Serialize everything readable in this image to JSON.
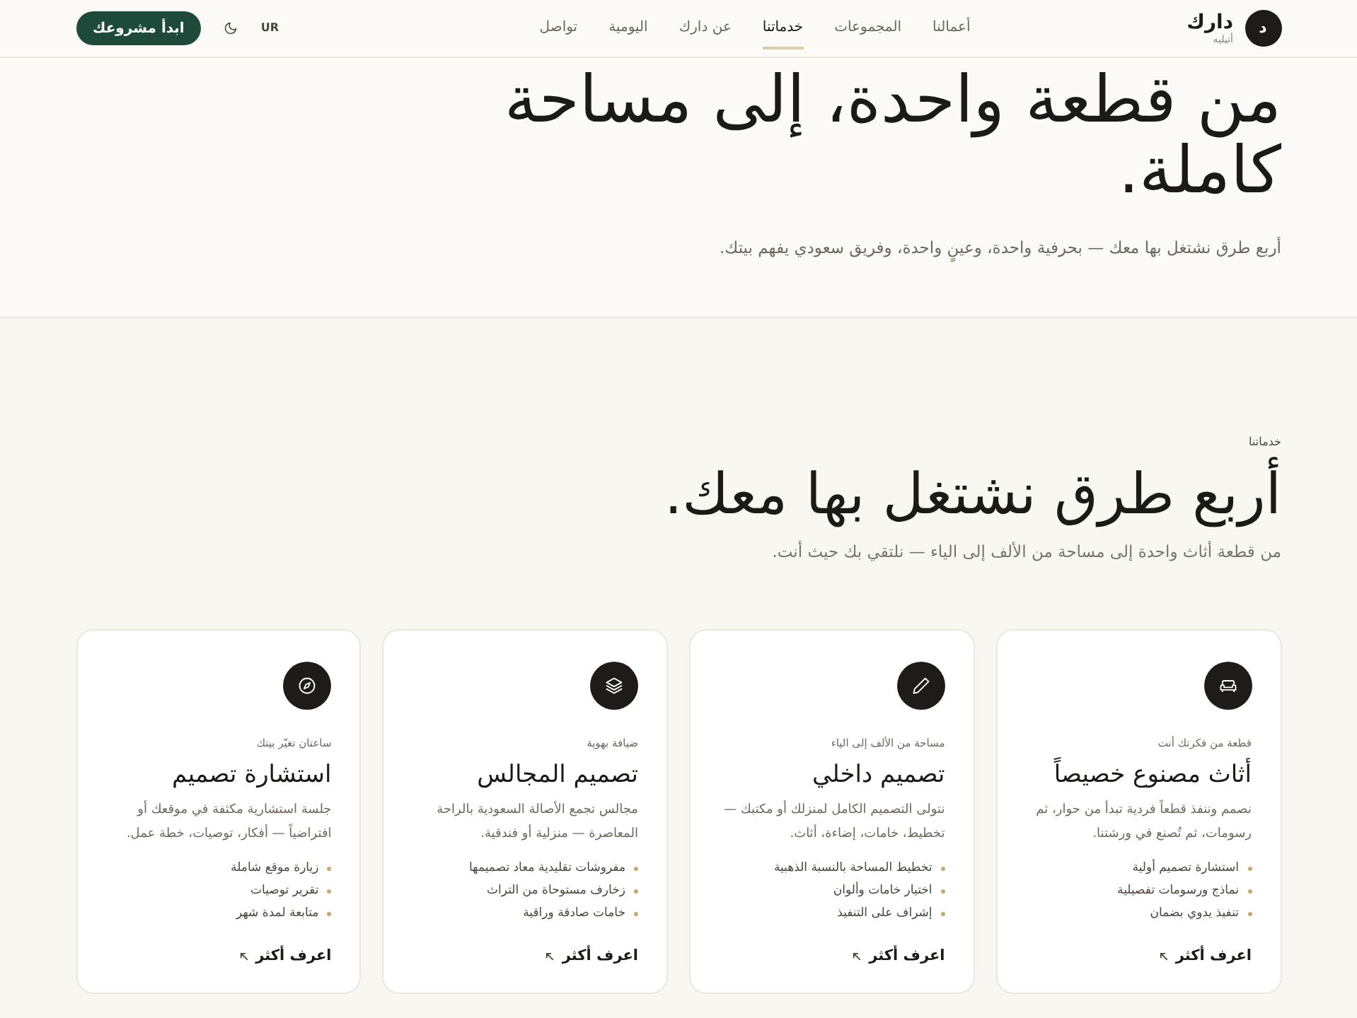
{
  "header": {
    "logo": {
      "mark": "د",
      "name": "دارك",
      "tagline": "أتيليه"
    },
    "nav": [
      {
        "label": "أعمالنا",
        "selected": false
      },
      {
        "label": "المجموعات",
        "selected": false
      },
      {
        "label": "خدماتنا",
        "selected": true
      },
      {
        "label": "عن دارك",
        "selected": false
      },
      {
        "label": "اليومية",
        "selected": false
      },
      {
        "label": "تواصل",
        "selected": false
      }
    ],
    "language": "UR",
    "cta": "ابدأ مشروعك"
  },
  "hero": {
    "title": "من قطعة واحدة، إلى مساحة كاملة.",
    "subtitle": "أربع طرق نشتغل بها معك — بحرفية واحدة، وعينٍ واحدة، وفريق سعودي يفهم بيتك."
  },
  "services": {
    "eyebrow": "خدماتنا",
    "title": "أربع طرق نشتغل بها معك.",
    "subtitle": "من قطعة أثاث واحدة إلى مساحة من الألف إلى الياء — نلتقي بك حيث أنت.",
    "cards": [
      {
        "eyebrow": "قطعة من فكرتك أنت",
        "title": "أثاث مصنوع خصيصاً",
        "description": "نصمم وننفذ قطعاً فردية تبدأ من حوار، ثم رسومات، ثم تُصنع في ورشتنا.",
        "features": [
          "استشارة تصميم أولية",
          "نماذج ورسومات تفصيلية",
          "تنفيذ يدوي بضمان"
        ],
        "link": "اعرف أكثر"
      },
      {
        "eyebrow": "مساحة من الألف إلى الياء",
        "title": "تصميم داخلي",
        "description": "نتولى التصميم الكامل لمنزلك أو مكتبك — تخطيط، خامات، إضاءة، أثاث.",
        "features": [
          "تخطيط المساحة بالنسبة الذهبية",
          "اختيار خامات وألوان",
          "إشراف على التنفيذ"
        ],
        "link": "اعرف أكثر"
      },
      {
        "eyebrow": "ضيافة بهوية",
        "title": "تصميم المجالس",
        "description": "مجالس تجمع الأصالة السعودية بالراحة المعاصرة — منزلية أو فندقية.",
        "features": [
          "مفروشات تقليدية معاد تصميمها",
          "زخارف مستوحاة من التراث",
          "خامات صادقة وراقية"
        ],
        "link": "اعرف أكثر"
      },
      {
        "eyebrow": "ساعتان تغيّر بيتك",
        "title": "استشارة تصميم",
        "description": "جلسة استشارية مكثفة في موقعك أو افتراضياً — أفكار، توصيات، خطة عمل.",
        "features": [
          "زيارة موقع شاملة",
          "تقرير توصيات",
          "متابعة لمدة شهر"
        ],
        "link": "اعرف أكثر"
      }
    ]
  }
}
